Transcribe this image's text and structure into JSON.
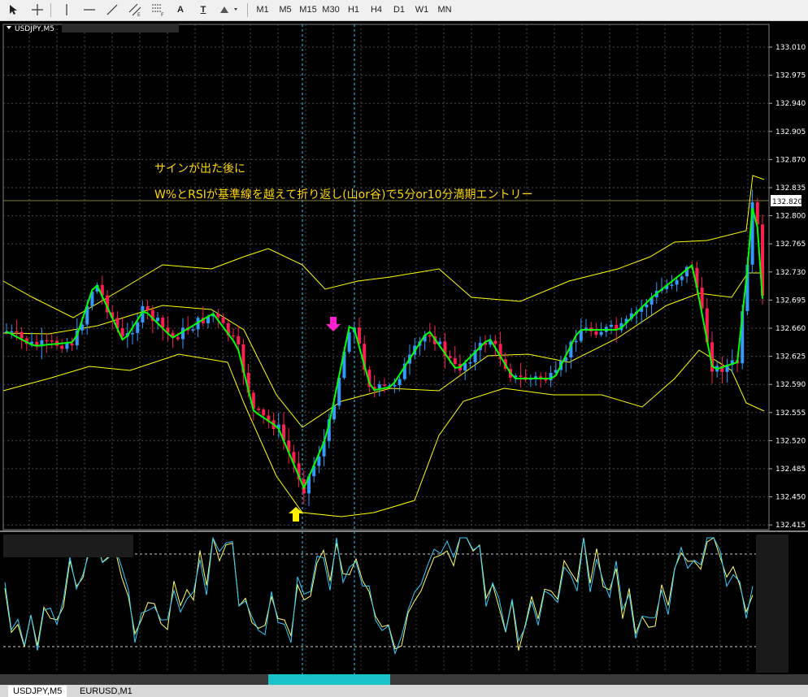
{
  "toolbar": {
    "tools": [
      {
        "name": "cursor-icon"
      },
      {
        "name": "crosshair-icon"
      },
      {
        "name": "vertical-line-icon"
      },
      {
        "name": "horizontal-line-icon"
      },
      {
        "name": "trendline-icon"
      },
      {
        "name": "equidistant-channel-icon"
      },
      {
        "name": "fibonacci-icon"
      },
      {
        "name": "text-icon",
        "label": "A"
      },
      {
        "name": "text-label-icon",
        "label": "T"
      },
      {
        "name": "arrows-menu-icon"
      }
    ],
    "timeframes": [
      "M1",
      "M5",
      "M15",
      "M30",
      "H1",
      "H4",
      "D1",
      "W1",
      "MN"
    ]
  },
  "chart": {
    "title": "USDJPY,M5",
    "annotation_line1": "サインが出た後に",
    "annotation_line2": "W%とRSIが基準線を越えて折り返し(山or谷)で5分or10分満期エントリー",
    "current_price": "132.820",
    "price_axis": [
      "133.010",
      "132.975",
      "132.940",
      "132.905",
      "132.870",
      "132.835",
      "132.800",
      "132.765",
      "132.730",
      "132.695",
      "132.660",
      "132.625",
      "132.590",
      "132.555",
      "132.520",
      "132.485",
      "132.450",
      "132.415"
    ],
    "colors": {
      "bull": "#3399ff",
      "bear": "#ff1e50",
      "ma": "#00ff00",
      "bands": "#ffff00",
      "osc1": "#ffff66",
      "osc2": "#33ccff",
      "signal_up": "#ffee00",
      "signal_down": "#ff22cc"
    }
  },
  "tabs": [
    "USDJPY,M5",
    "EURUSD,M1"
  ]
}
